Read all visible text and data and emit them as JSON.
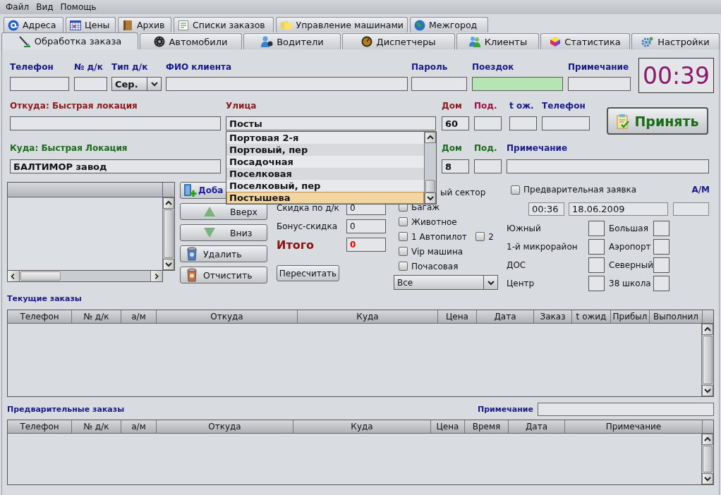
{
  "menu": [
    "Файл",
    "Вид",
    "Помощь"
  ],
  "tabs_top": [
    {
      "label": "Адреса",
      "selected": false
    },
    {
      "label": "Цены",
      "selected": false
    },
    {
      "label": "Архив",
      "selected": false
    },
    {
      "label": "Списки заказов",
      "selected": false
    },
    {
      "label": "Управление машинами",
      "selected": false
    },
    {
      "label": "Межгород",
      "selected": false
    }
  ],
  "tabs": [
    {
      "label": "Обработка заказа",
      "selected": true
    },
    {
      "label": "Автомобили",
      "selected": false
    },
    {
      "label": "Водители",
      "selected": false
    },
    {
      "label": "Диспетчеры",
      "selected": false
    },
    {
      "label": "Клиенты",
      "selected": false
    },
    {
      "label": "Статистика",
      "selected": false
    },
    {
      "label": "Настройки",
      "selected": false
    }
  ],
  "client": {
    "fields": [
      {
        "label": "Телефон",
        "kind": "text"
      },
      {
        "label": "№ д/к",
        "kind": "text"
      },
      {
        "label": "Тип д/к",
        "kind": "combo",
        "value": "Сер."
      },
      {
        "label": "ФИО клиента",
        "kind": "text"
      },
      {
        "label": "Пароль",
        "kind": "text"
      },
      {
        "label": "Поездок",
        "kind": "counter"
      },
      {
        "label": "Примечание",
        "kind": "text"
      }
    ],
    "timer": "00:39"
  },
  "from": {
    "fields": [
      {
        "label": "Откуда: Быстрая локация",
        "color": "#8b1a1a"
      },
      {
        "label": "Улица",
        "color": "#8b1a1a",
        "value": "Посты"
      },
      {
        "label": "Дом",
        "color": "#8b1a1a",
        "value": "60"
      },
      {
        "label": "Под.",
        "color": "#a0103a"
      },
      {
        "label": "t ож.",
        "color": "#1a1a8b"
      },
      {
        "label": "Телефон",
        "color": "#1a1a8b"
      }
    ]
  },
  "accept_button": "Принять",
  "street_dropdown": [
    {
      "label": "Портовая 2-я",
      "selected": false
    },
    {
      "label": "Портовый, пер",
      "selected": false
    },
    {
      "label": "Посадочная",
      "selected": false
    },
    {
      "label": "Поселковая",
      "selected": false
    },
    {
      "label": "Поселковый, пер",
      "selected": false
    },
    {
      "label": "Постышева",
      "selected": true
    }
  ],
  "to": {
    "fields": [
      {
        "label": "Куда: Быстрая Локация",
        "color": "#1a6b1a",
        "value": "БАЛТИМОР завод"
      },
      {
        "label": "Дом",
        "color": "#1a6b1a",
        "value": "8"
      },
      {
        "label": "Под.",
        "color": "#1a6b1a"
      },
      {
        "label": "Примечание",
        "color": "#1a1a8b"
      }
    ]
  },
  "route_buttons": [
    "Доба",
    "Вверх",
    "Вниз",
    "Удалить",
    "Отчистить"
  ],
  "price": {
    "rows": [
      {
        "label": "Скидка по д/к",
        "value": "0",
        "kind": "discount"
      },
      {
        "label": "Бонус-скидка",
        "value": "0",
        "kind": "discount"
      },
      {
        "label": "Итого",
        "value": "0",
        "kind": "total"
      }
    ],
    "recalc_button": "Пересчитать"
  },
  "options": [
    {
      "kind": "text",
      "label": "ый сектор"
    },
    {
      "kind": "checkbox",
      "label": "Багаж",
      "checked": false
    },
    {
      "kind": "checkbox",
      "label": "Животное",
      "checked": false
    },
    {
      "kind": "checkbox",
      "label": "1 Автопилот",
      "checked": false,
      "second": {
        "label": "2",
        "checked": false
      }
    },
    {
      "kind": "checkbox",
      "label": "Vip машина",
      "checked": false
    },
    {
      "kind": "checkbox",
      "label": "Почасовая",
      "checked": false
    }
  ],
  "car_filter": "Все",
  "preorder": {
    "label": "Предварительная заявка",
    "checked": false,
    "car_label": "А/М",
    "time": "00:36",
    "date": "18.06.2009"
  },
  "districts": [
    {
      "label": "Южный"
    },
    {
      "label": "Большая"
    },
    {
      "label": "1-й микрорайон"
    },
    {
      "label": "Аэропорт"
    },
    {
      "label": "ДОС"
    },
    {
      "label": "Северный"
    },
    {
      "label": "Центр"
    },
    {
      "label": "38 школа"
    }
  ],
  "current_orders": {
    "title": "Текущие заказы",
    "columns": [
      "Телефон",
      "№ д/к",
      "а/м",
      "Откуда",
      "Куда",
      "Цена",
      "Дата",
      "Заказ",
      "t ожид",
      "Прибыл",
      "Выполнил"
    ]
  },
  "pre_orders": {
    "title": "Предварительные заказы",
    "note_label": "Примечание",
    "columns": [
      "Телефон",
      "№ д/к",
      "а/м",
      "Откуда",
      "Куда",
      "Цена",
      "Время",
      "Дата",
      "Примечание"
    ]
  }
}
